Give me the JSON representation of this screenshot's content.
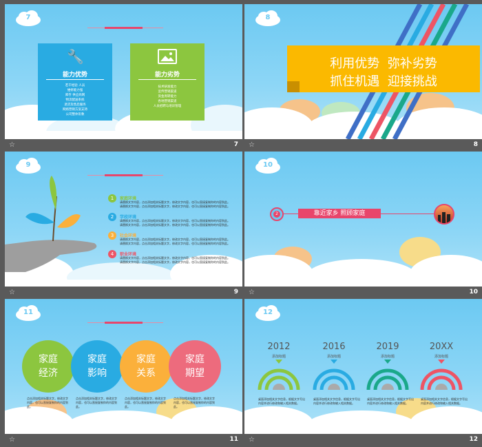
{
  "slides": [
    {
      "number": "7",
      "left_title": "能力优势",
      "left_items": [
        "若干经验 人员",
        "维修能力强",
        "库存 供应商网",
        "物流配送系统",
        "退货及售后服务",
        "网络营销方案支持",
        "公司整体形象"
      ],
      "right_title": "能力劣势",
      "right_items": [
        "技术研发能力",
        "宣传营销渠道",
        "资金周转能力",
        "各地营销渠道",
        "人员招聘与培训管理"
      ]
    },
    {
      "number": "8",
      "line1": "利用优势  弥补劣势",
      "line2": "抓住机遇  迎接挑战"
    },
    {
      "number": "9",
      "items": [
        {
          "n": "1",
          "title": "家庭环境",
          "color": "#8cc63f",
          "text": "请替换文字内容，点击添加相关标题文字，修改文字内容，也可以直接复制你的内容到此。请替换文字内容，点击添加相关标题文字，修改文字内容，也可以直接复制你的内容到此。"
        },
        {
          "n": "2",
          "title": "学校环境",
          "color": "#29abe2",
          "text": "请替换文字内容，点击添加相关标题文字，修改文字内容，也可以直接复制你的内容到此。请替换文字内容，点击添加相关标题文字，修改文字内容，也可以直接复制你的内容到此。"
        },
        {
          "n": "3",
          "title": "社会环境",
          "color": "#fbb03b",
          "text": "请替换文字内容，点击添加相关标题文字，修改文字内容，也可以直接复制你的内容到此。请替换文字内容，点击添加相关标题文字，修改文字内容，也可以直接复制你的内容到此。"
        },
        {
          "n": "4",
          "title": "职业环境",
          "color": "#ed5565",
          "text": "请替换文字内容，点击添加相关标题文字，修改文字内容，也可以直接复制你的内容到此。请替换文字内容，点击添加相关标题文字，修改文字内容，也可以直接复制你的内容到此。"
        }
      ]
    },
    {
      "number": "10",
      "circle": "2",
      "banner": "靠近家乡 照顾家庭"
    },
    {
      "number": "11",
      "circles": [
        {
          "l1": "家庭",
          "l2": "经济",
          "color": "#8cc63f"
        },
        {
          "l1": "家庭",
          "l2": "影响",
          "color": "#29abe2"
        },
        {
          "l1": "家庭",
          "l2": "关系",
          "color": "#fbb03b"
        },
        {
          "l1": "家庭",
          "l2": "期望",
          "color": "#ed6b7d"
        }
      ],
      "texts": [
        "点击添加相关标题文字，修改文字内容，也可以直接复制你的内容到此。",
        "点击添加相关标题文字，修改文字内容，也可以直接复制你的内容到此。",
        "点击添加相关标题文字，修改文字内容，也可以直接复制你的内容到此。",
        "点击添加相关标题文字，修改文字内容，也可以直接复制你的内容到此。"
      ]
    },
    {
      "number": "12",
      "timeline": [
        {
          "year": "2012",
          "label": "添加标题",
          "color": "#8cc63f",
          "text": "桌面添加相关文字信息，根据文字写出内容并进行修改和输入相关数据。"
        },
        {
          "year": "2016",
          "label": "添加标题",
          "color": "#29abe2",
          "text": "桌面添加相关文字信息，根据文字写出内容并进行修改和输入相关数据。"
        },
        {
          "year": "2019",
          "label": "添加标题",
          "color": "#1aa88a",
          "text": "桌面添加相关文字信息，根据文字写出内容并进行修改和输入相关数据。"
        },
        {
          "year": "20XX",
          "label": "添加标题",
          "color": "#ed5565",
          "text": "桌面添加相关文字信息，根据文字写出内容并进行修改和输入相关数据。"
        }
      ]
    }
  ],
  "footer_star": "☆",
  "colors": {
    "sky": "#6cc9f2",
    "pink": "#e8456b",
    "yellow": "#fbb900",
    "blue_card": "#29abe2",
    "green_card": "#8cc63f"
  }
}
